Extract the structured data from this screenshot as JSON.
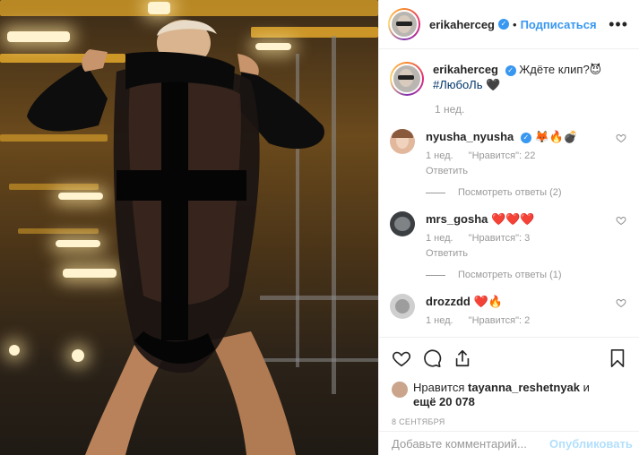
{
  "post": {
    "author": "erikaherceg",
    "follow_label": "Подписаться",
    "separator": "•",
    "more_icon": "more-horizontal-icon"
  },
  "caption": {
    "username": "erikaherceg",
    "text": "Ждёте клип?😈",
    "hashtag": "#ЛюбоЛь",
    "suffix": "🖤",
    "time": "1 нед."
  },
  "comments": [
    {
      "username": "nyusha_nyusha",
      "text": "🦊🔥💣",
      "verified": true,
      "time": "1 нед.",
      "likes": "\"Нравится\": 22",
      "reply_label": "Ответить",
      "view_replies": "Посмотреть ответы (2)"
    },
    {
      "username": "mrs_gosha",
      "text": "❤️❤️❤️",
      "verified": false,
      "time": "1 нед.",
      "likes": "\"Нравится\": 3",
      "reply_label": "Ответить",
      "view_replies": "Посмотреть ответы (1)"
    },
    {
      "username": "drozzdd",
      "text": "❤️🔥",
      "verified": false,
      "time": "1 нед.",
      "likes": "\"Нравится\": 2",
      "reply_label": "",
      "view_replies": ""
    }
  ],
  "likes": {
    "prefix": "Нравится",
    "user": "tayanna_reshetnyak",
    "conj": "и",
    "more": "ещё 20 078"
  },
  "date": "8 СЕНТЯБРЯ",
  "add_comment": {
    "placeholder": "Добавьте комментарий...",
    "publish": "Опубликовать"
  },
  "colors": {
    "link_blue": "#3897f0",
    "publish_disabled": "#b2dffc",
    "muted": "#999999"
  },
  "icons": [
    "heart-icon",
    "comment-icon",
    "share-icon",
    "bookmark-icon",
    "verified-badge-icon",
    "small-heart-icon"
  ]
}
